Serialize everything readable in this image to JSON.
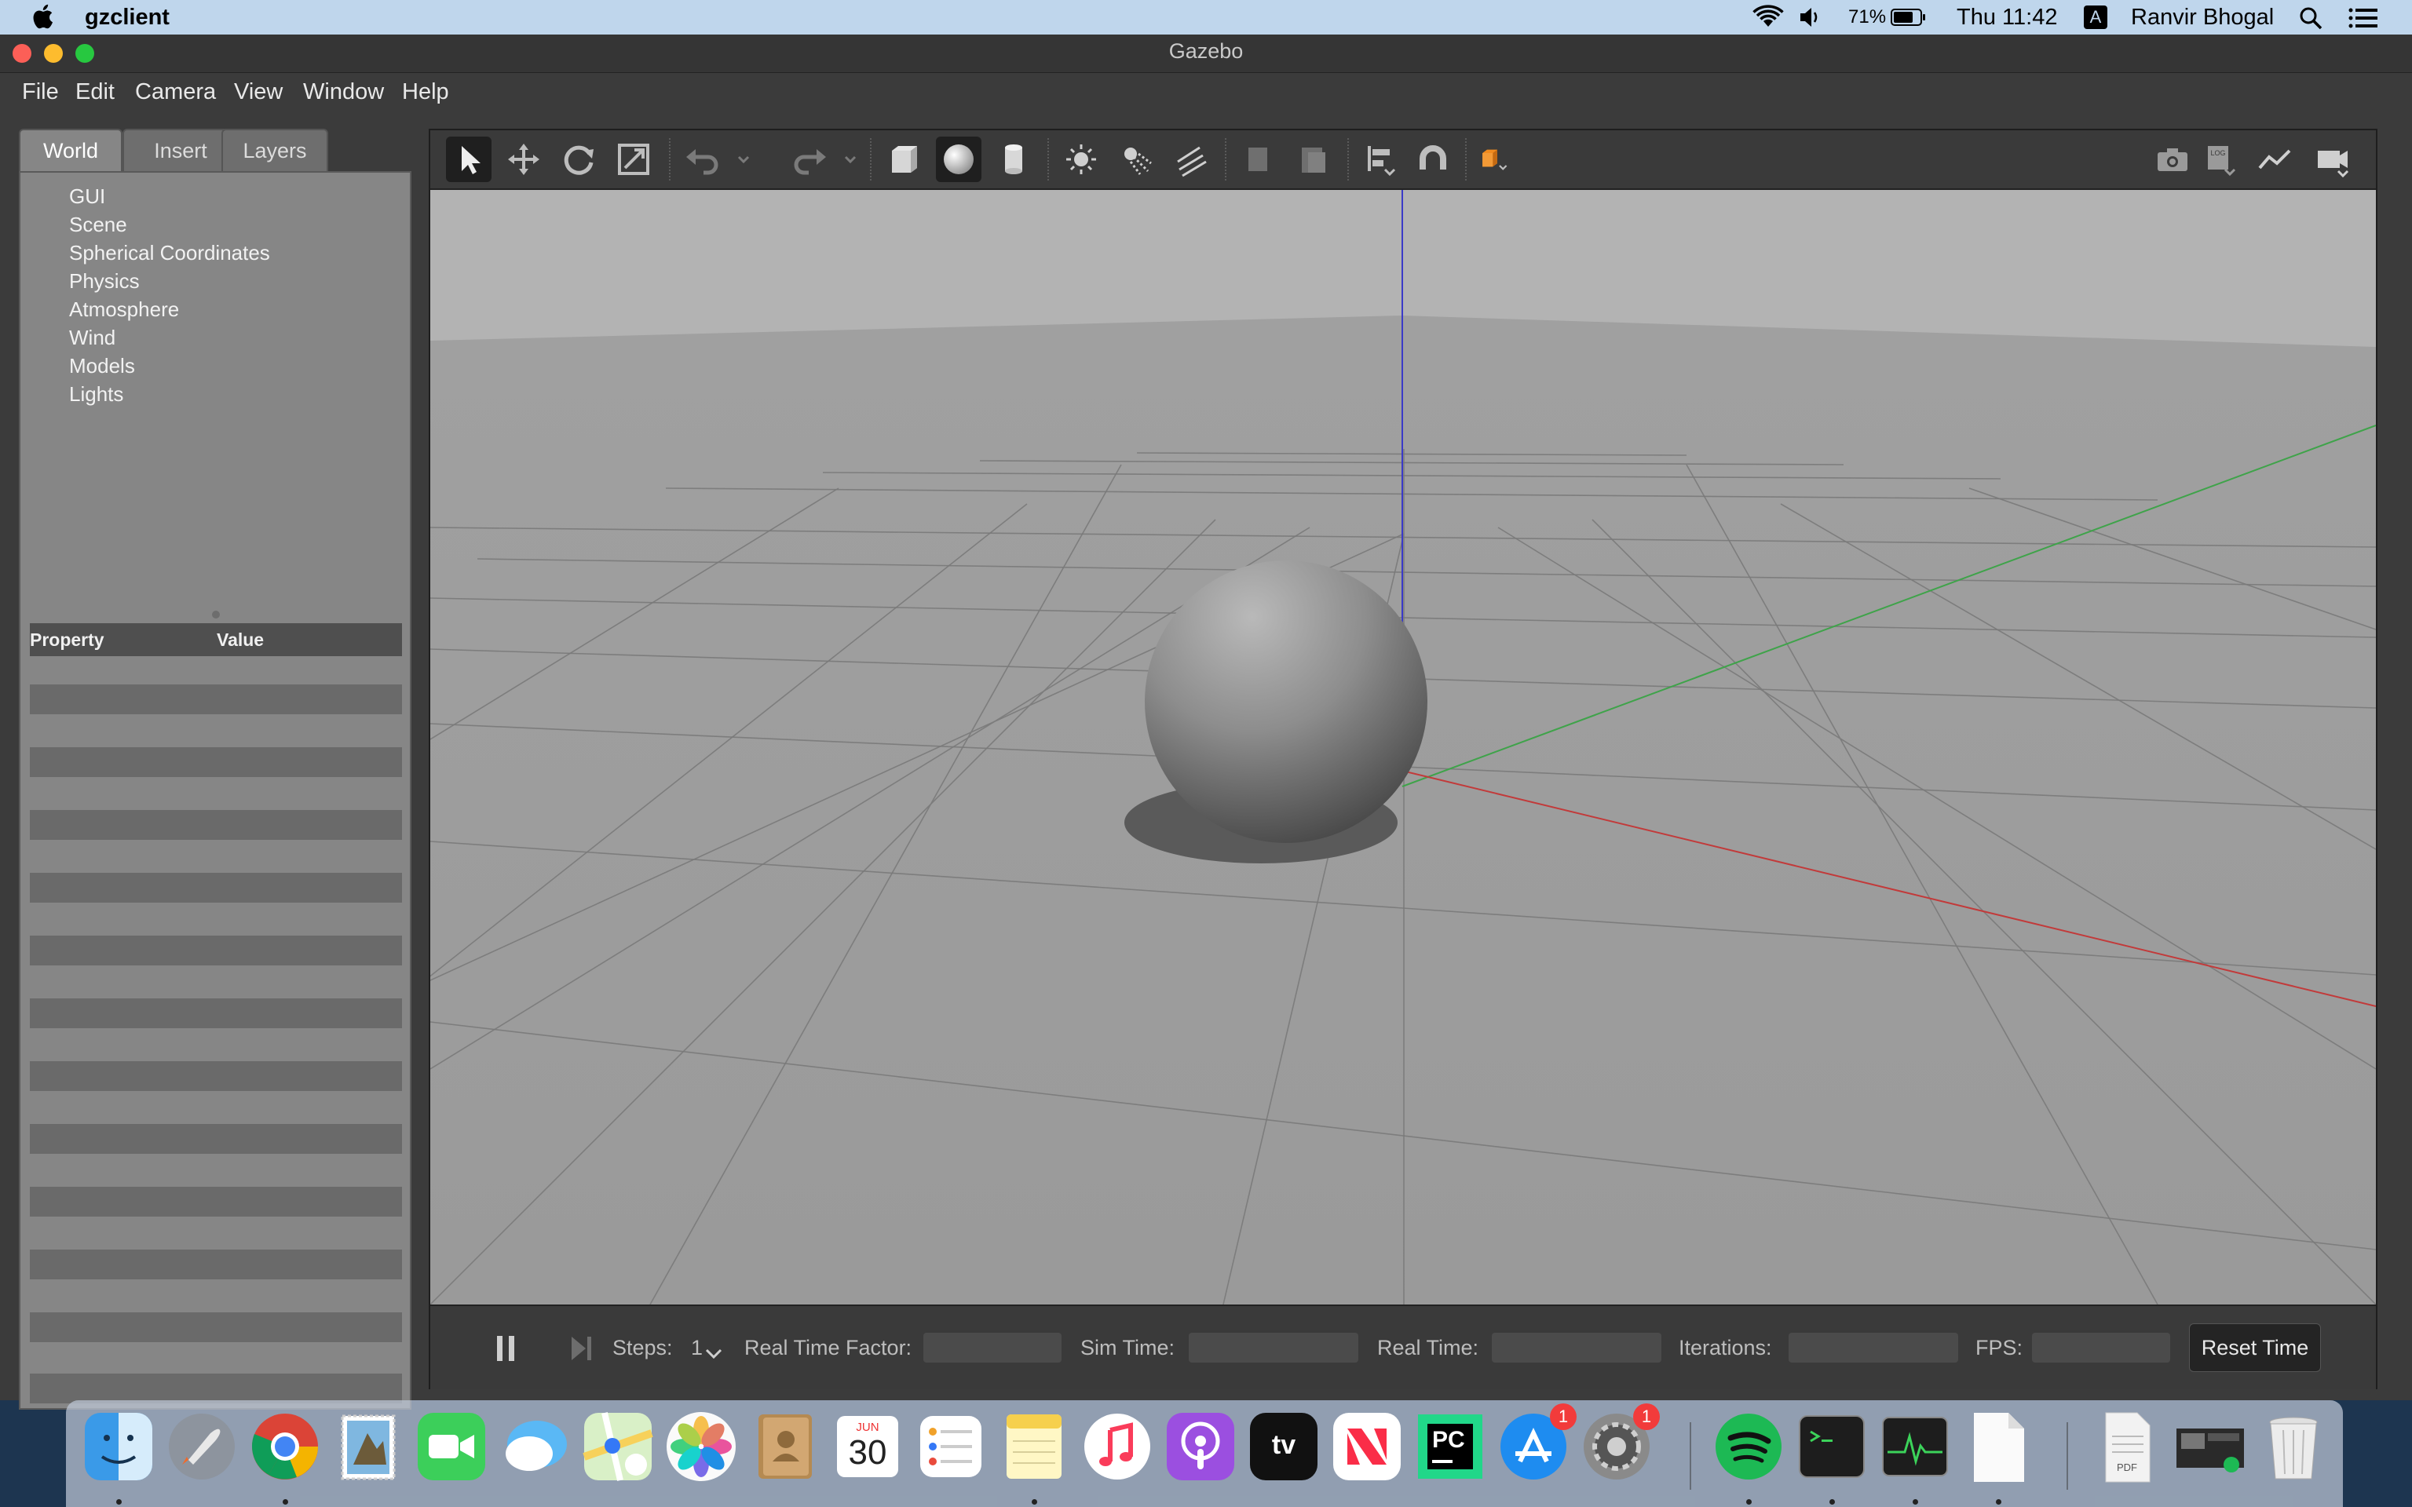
{
  "menubar": {
    "app_name": "gzclient",
    "battery": "71%",
    "clock": "Thu 11:42",
    "input_badge": "A",
    "user": "Ranvir Bhogal"
  },
  "window": {
    "title": "Gazebo",
    "menu": [
      "File",
      "Edit",
      "Camera",
      "View",
      "Window",
      "Help"
    ]
  },
  "left_panel": {
    "tabs": [
      "World",
      "Insert",
      "Layers"
    ],
    "active_tab": "World",
    "tree": [
      "GUI",
      "Scene",
      "Spherical Coordinates",
      "Physics",
      "Atmosphere",
      "Wind",
      "Models",
      "Lights"
    ],
    "property_header": "Property",
    "value_header": "Value"
  },
  "toolbar": {
    "tools": [
      "select-mode",
      "translate-mode",
      "rotate-mode",
      "scale-mode",
      "undo",
      "undo-history",
      "redo",
      "redo-history",
      "box-shape",
      "sphere-shape",
      "cylinder-shape",
      "point-light",
      "spot-light",
      "directional-light",
      "copy",
      "paste",
      "align",
      "snap",
      "view-angle"
    ],
    "right_tools": [
      "screenshot",
      "log",
      "plot",
      "video-record"
    ]
  },
  "bottom_bar": {
    "steps_label": "Steps:",
    "steps_value": "1",
    "real_time_factor_label": "Real Time Factor:",
    "sim_time_label": "Sim Time:",
    "real_time_label": "Real Time:",
    "iterations_label": "Iterations:",
    "fps_label": "FPS:",
    "reset_label": "Reset Time"
  },
  "dock": {
    "calendar_month": "JUN",
    "calendar_day": "30",
    "appstore_badge": "1",
    "settings_badge": "1",
    "pycharm_label": "PC",
    "tv_label": "tv",
    "pdf_label": "PDF"
  },
  "colors": {
    "menubar": "#bfd6ec",
    "window_bg": "#3b3b3b",
    "panel": "#868686",
    "viewport_floor": "#9d9d9d",
    "axis_x": "#c23a3a",
    "axis_y": "#3fa34a",
    "axis_z": "#3a3ac8",
    "accent_orange": "#f08a1e"
  }
}
